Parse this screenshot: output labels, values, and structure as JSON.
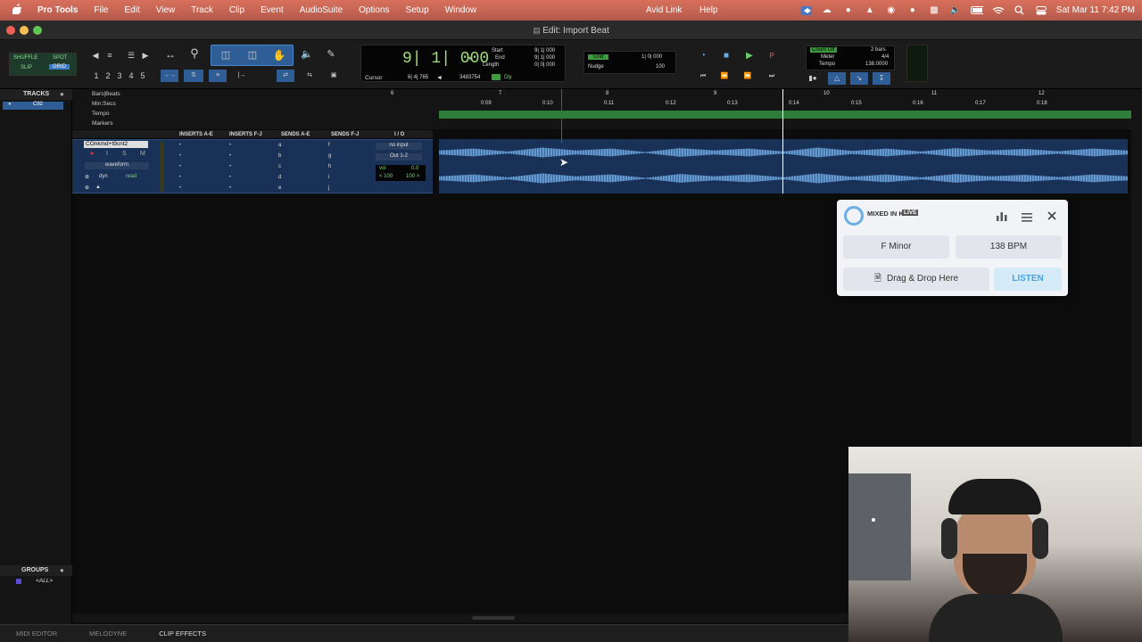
{
  "menubar": {
    "apple": "",
    "app": "Pro Tools",
    "items": [
      "File",
      "Edit",
      "View",
      "Track",
      "Clip",
      "Event",
      "AudioSuite",
      "Options",
      "Setup",
      "Window"
    ],
    "avid_link": "Avid Link",
    "help": "Help",
    "datetime": "Sat Mar 11  7:42 PM"
  },
  "window": {
    "title": "Edit: Import Beat"
  },
  "toolbar": {
    "modes": {
      "shuffle": "SHUFFLE",
      "spot": "SPOT",
      "slip": "SLIP",
      "grid": "GRID"
    },
    "zoom_presets": [
      "1",
      "2",
      "3",
      "4",
      "5"
    ],
    "counter": {
      "main": "9| 1| 000",
      "cursor_label": "Cursor",
      "cursor": "6| 4| 765",
      "sample": "3483754",
      "start_label": "Start",
      "end_label": "End",
      "length_label": "Length",
      "start": "9| 1| 000",
      "end": "9| 1| 000",
      "length": "0| 0| 000",
      "dly": "Dly"
    },
    "grid": {
      "label": "Grid",
      "value": "1| 0| 000",
      "nudge_label": "Nudge",
      "nudge": "100"
    },
    "meter": {
      "count_off": "Count Off",
      "bars": "2 bars",
      "meter_label": "Meter",
      "meter": "4/4",
      "tempo_label": "Tempo",
      "tempo": "138.0000"
    }
  },
  "tracks_panel": {
    "title": "TRACKS",
    "item": "C92",
    "groups_title": "GROUPS",
    "groups_item": "<ALL>"
  },
  "rulers": {
    "names": [
      "Bars|Beats",
      "Min:Secs",
      "Tempo",
      "Markers"
    ],
    "bars": [
      "6",
      "7",
      "8",
      "9",
      "10",
      "11",
      "12"
    ],
    "secs": [
      "0:09",
      "0:10",
      "0:11",
      "0:12",
      "0:13",
      "0:14",
      "0:15",
      "0:16",
      "0:17",
      "0:18"
    ]
  },
  "mix_headers": [
    "INSERTS A-E",
    "INSERTS F-J",
    "SENDS A-E",
    "SENDS F-J",
    "I / O"
  ],
  "track": {
    "name": "COnkmd+t9cnt2",
    "view": "waveform",
    "dyn": "dyn",
    "read": "read",
    "sends_ae": [
      "a",
      "b",
      "c",
      "d",
      "e"
    ],
    "sends_fj": [
      "f",
      "g",
      "h",
      "i",
      "j"
    ],
    "input": "no input",
    "output": "Out 1-2",
    "vol_label": "vol",
    "vol": "0.0",
    "pan_l": "< 100",
    "pan_r": "100 >"
  },
  "mixed_in_key": {
    "logo": "MIXED IN KEY",
    "badge": "LIVE",
    "key": "F Minor",
    "bpm": "138 BPM",
    "drop": "Drag & Drop Here",
    "listen": "LISTEN"
  },
  "bottom_tabs": [
    "MIDI EDITOR",
    "MELODYNE",
    "CLIP EFFECTS"
  ],
  "colors": {
    "menubar": "#c8654f",
    "wave": "#5a90c8",
    "tempo_ruler": "#2e7d3a",
    "mik_accent": "#4aa3e0"
  }
}
